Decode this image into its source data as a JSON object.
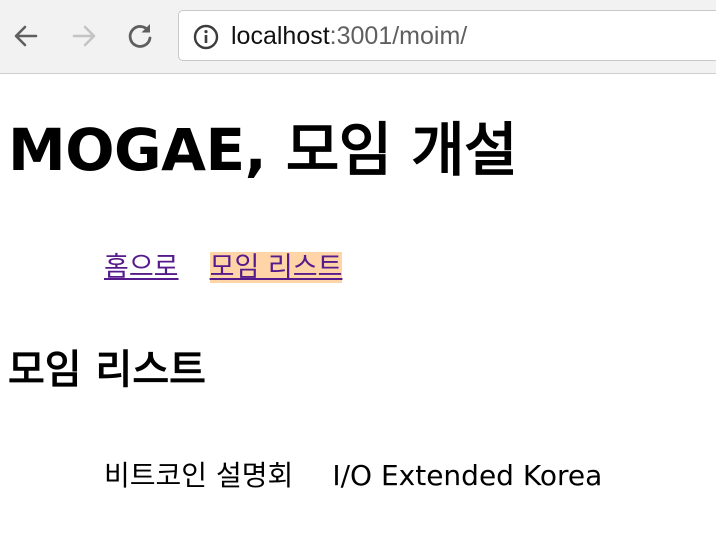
{
  "browser": {
    "url_host": "localhost",
    "url_rest": ":3001/moim/",
    "icons": {
      "back": "arrow-left-icon",
      "forward": "arrow-right-icon",
      "reload": "reload-icon",
      "info": "info-icon"
    },
    "colors": {
      "toolbar_bg": "#f2f2f2",
      "icon_active": "#5f5f5f",
      "icon_disabled": "#c4c4c4"
    }
  },
  "page": {
    "title": "MOGAE, 모임 개설",
    "nav": {
      "items": [
        {
          "label": "홈으로",
          "active": false
        },
        {
          "label": "모임 리스트",
          "active": true
        }
      ]
    },
    "section_title": "모임 리스트",
    "meetings": [
      {
        "name": "비트코인 설명회"
      },
      {
        "name": "I/O Extended Korea"
      }
    ],
    "colors": {
      "link": "#551a8b",
      "active_highlight": "#ffd4a6"
    }
  }
}
